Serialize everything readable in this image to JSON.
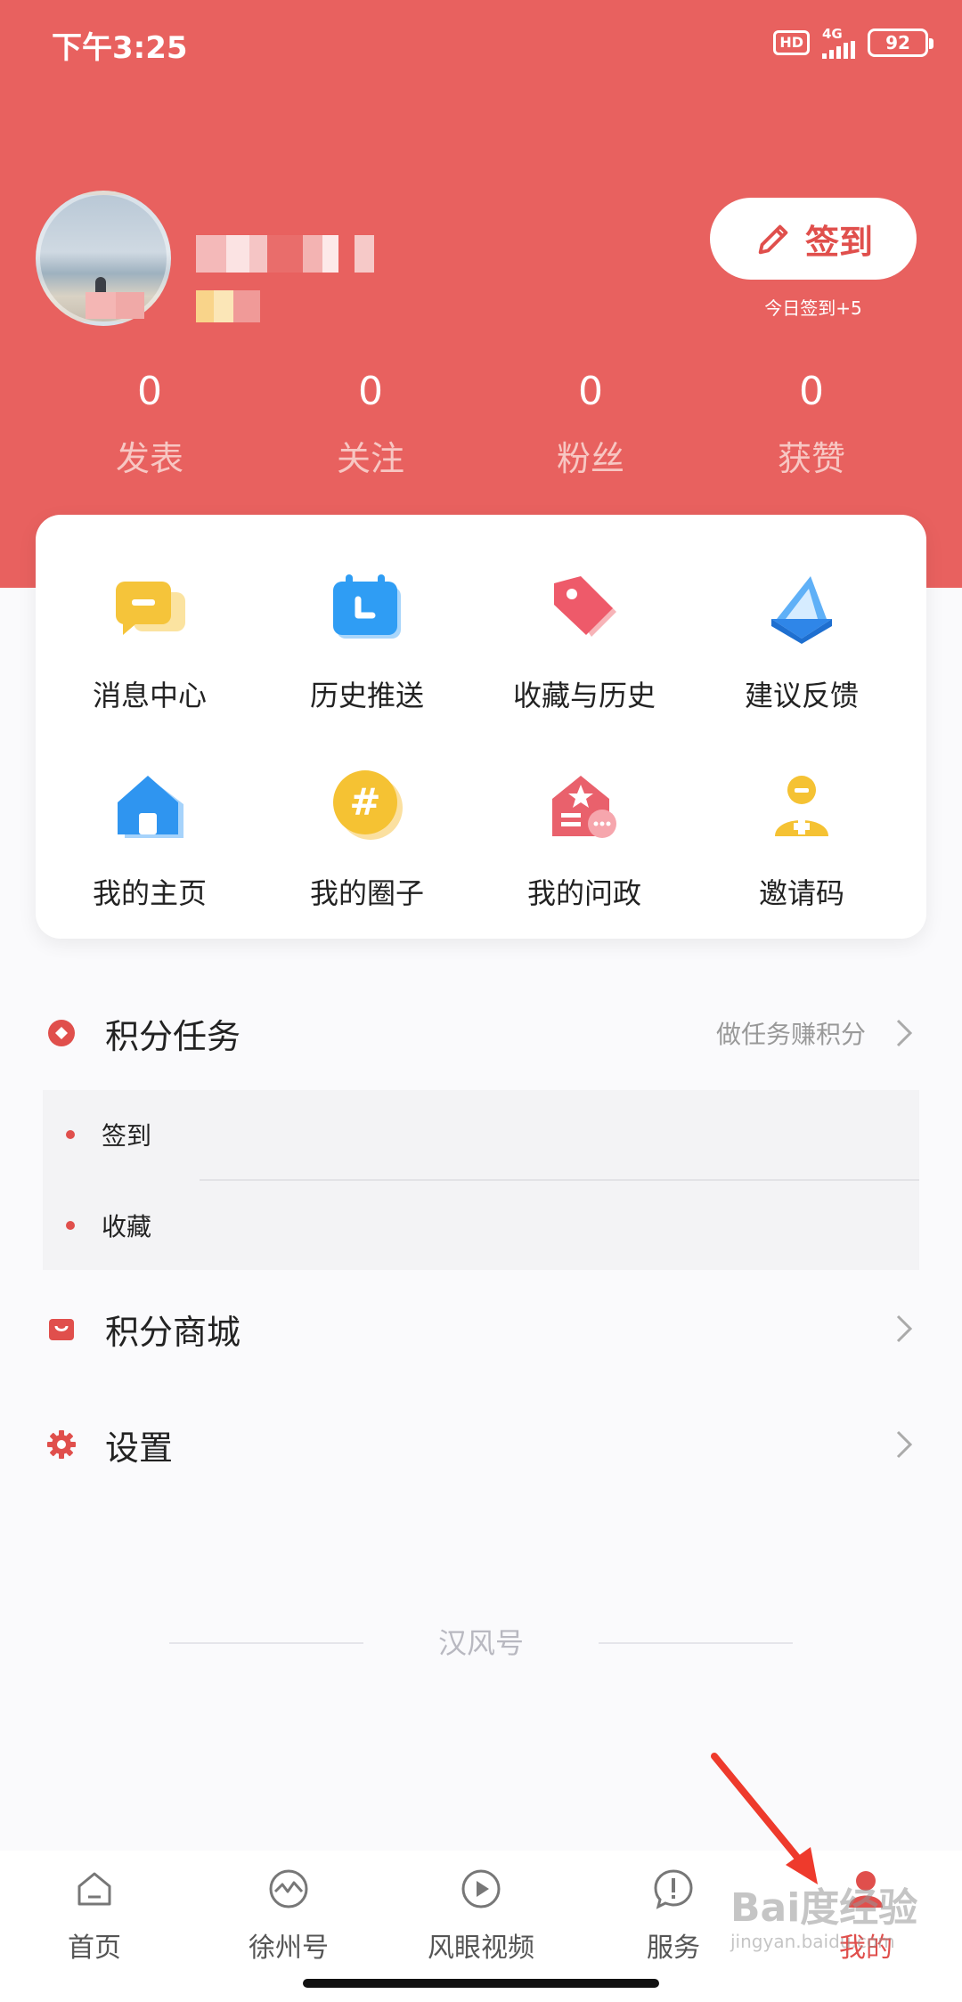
{
  "status_bar": {
    "time": "下午3:25",
    "hd": "HD",
    "network": "4G",
    "battery": "92"
  },
  "profile": {
    "signin_label": "签到",
    "signin_note": "今日签到+5"
  },
  "stats": [
    {
      "value": "0",
      "label": "发表"
    },
    {
      "value": "0",
      "label": "关注"
    },
    {
      "value": "0",
      "label": "粉丝"
    },
    {
      "value": "0",
      "label": "获赞"
    }
  ],
  "grid": [
    {
      "label": "消息中心",
      "icon": "message-center-icon"
    },
    {
      "label": "历史推送",
      "icon": "calendar-icon"
    },
    {
      "label": "收藏与历史",
      "icon": "tag-icon"
    },
    {
      "label": "建议反馈",
      "icon": "envelope-icon"
    },
    {
      "label": "我的主页",
      "icon": "home-icon"
    },
    {
      "label": "我的圈子",
      "icon": "hashtag-icon"
    },
    {
      "label": "我的问政",
      "icon": "gov-house-icon"
    },
    {
      "label": "邀请码",
      "icon": "invite-user-icon"
    }
  ],
  "points_task": {
    "title": "积分任务",
    "hint": "做任务赚积分",
    "items": [
      "签到",
      "收藏"
    ]
  },
  "points_mall": {
    "title": "积分商城"
  },
  "settings": {
    "title": "设置"
  },
  "footer_brand": "汉风号",
  "tabbar": [
    {
      "label": "首页",
      "icon": "home-outline-icon"
    },
    {
      "label": "徐州号",
      "icon": "pulse-circle-icon"
    },
    {
      "label": "风眼视频",
      "icon": "play-circle-icon"
    },
    {
      "label": "服务",
      "icon": "alert-bubble-icon"
    },
    {
      "label": "我的",
      "icon": "user-icon"
    }
  ],
  "watermark": {
    "main": "Bai度经验",
    "sub": "jingyan.baidu.com"
  },
  "colors": {
    "brand_red": "#e8615f",
    "accent_red": "#e04f4c",
    "stat_label": "#f7c7c3"
  }
}
